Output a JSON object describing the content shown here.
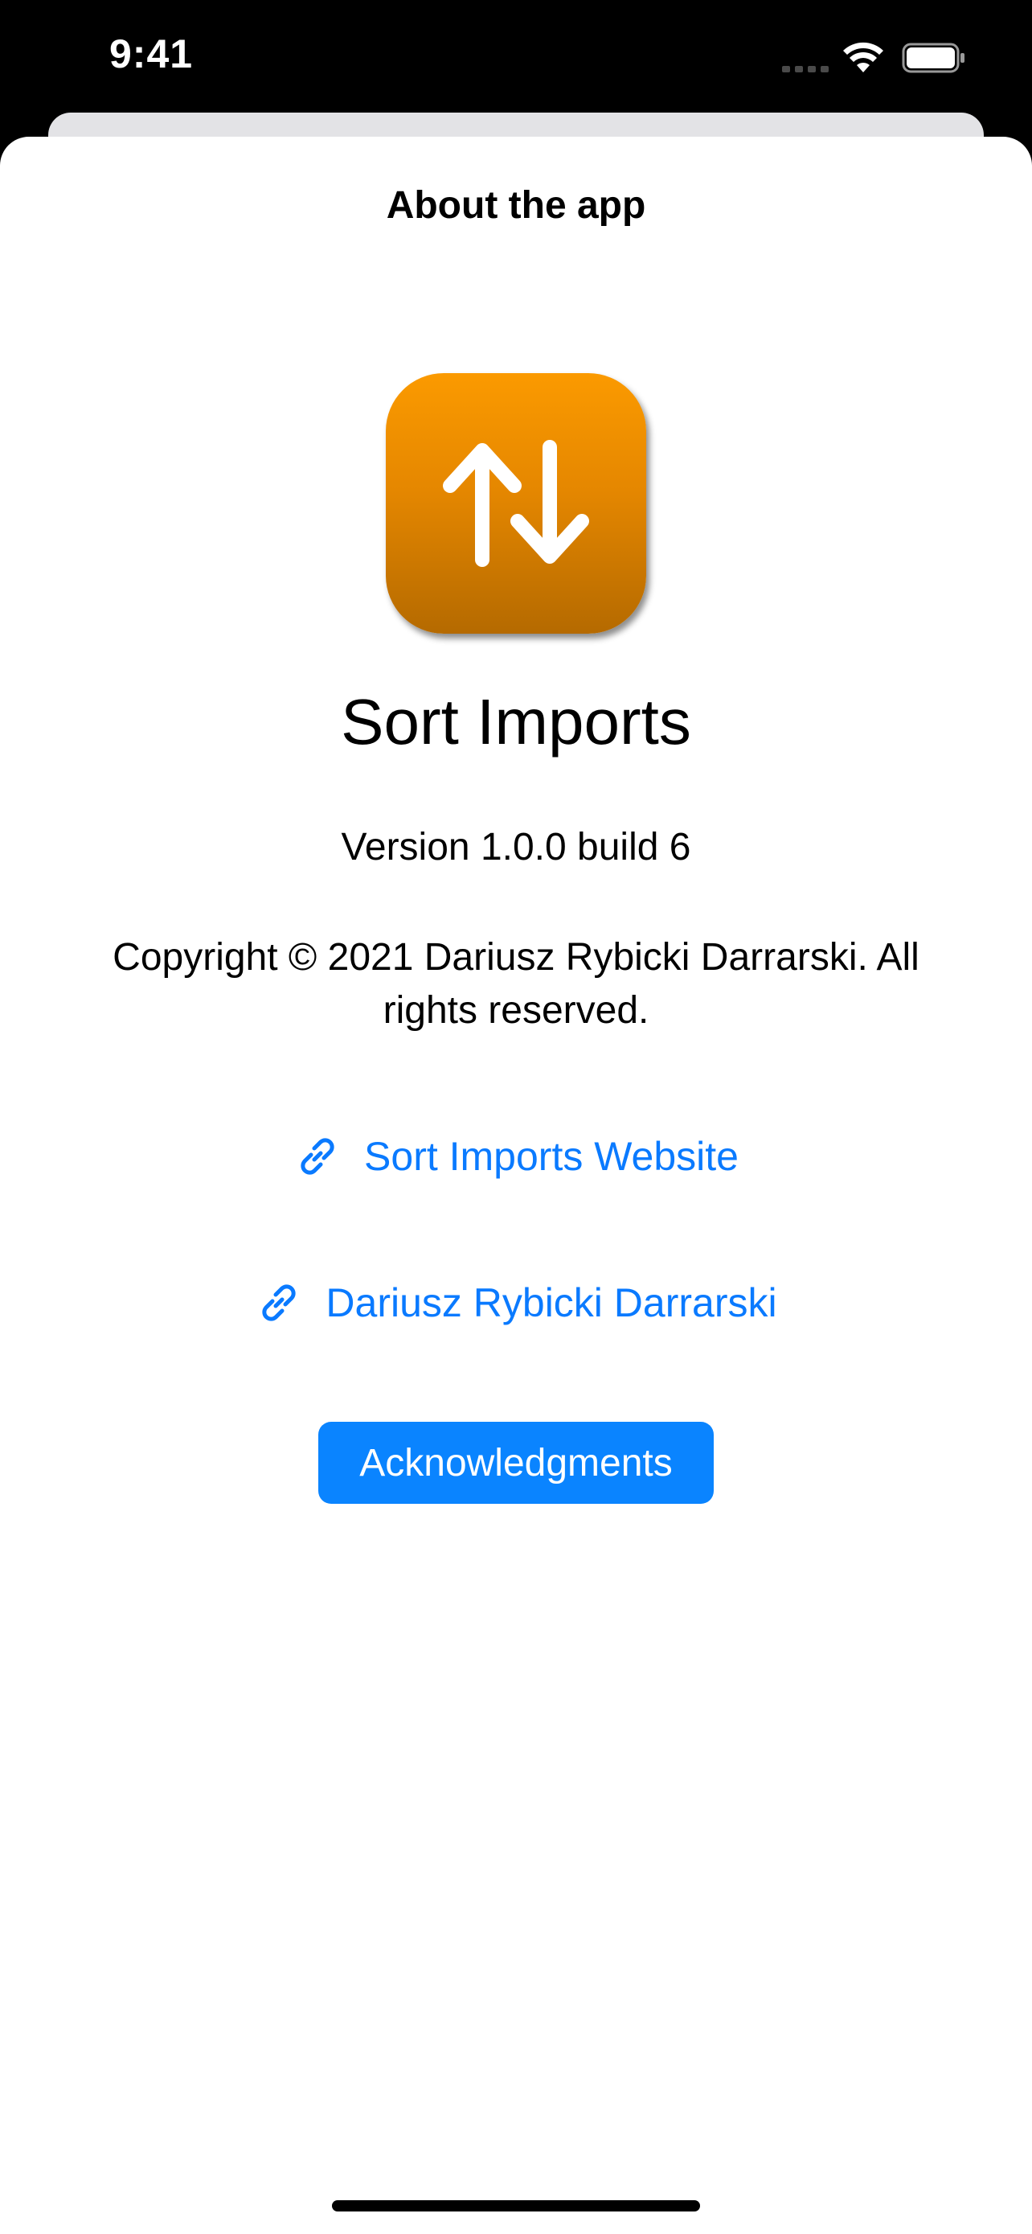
{
  "status_bar": {
    "time": "9:41",
    "signal_icon": "cellular-signal-icon",
    "wifi_icon": "wifi-icon",
    "battery_icon": "battery-icon"
  },
  "sheet": {
    "title": "About the app"
  },
  "app": {
    "icon": "sort-arrows-icon",
    "name": "Sort Imports",
    "version": "Version 1.0.0 build 6",
    "copyright": "Copyright © 2021 Dariusz Rybicki Darrarski. All rights reserved."
  },
  "links": [
    {
      "label": "Sort Imports Website",
      "icon": "link-icon"
    },
    {
      "label": "Dariusz Rybicki Darrarski",
      "icon": "link-icon"
    }
  ],
  "buttons": {
    "acknowledgments_label": "Acknowledgments"
  },
  "colors": {
    "accent": "#0a84ff",
    "link": "#0a7aff",
    "app_icon_top": "#fb9a00",
    "app_icon_bottom": "#b56a00"
  }
}
